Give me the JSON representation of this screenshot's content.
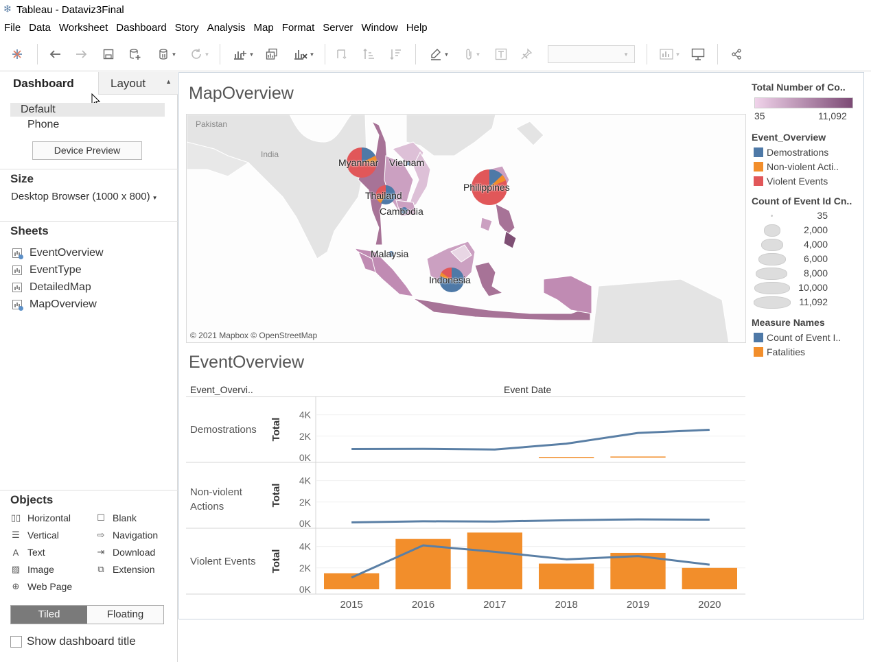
{
  "window": {
    "title": "Tableau - Dataviz3Final"
  },
  "menu": [
    "File",
    "Data",
    "Worksheet",
    "Dashboard",
    "Story",
    "Analysis",
    "Map",
    "Format",
    "Server",
    "Window",
    "Help"
  ],
  "left_panel": {
    "tab_dashboard": "Dashboard",
    "tab_layout": "Layout",
    "devices": {
      "default": "Default",
      "phone": "Phone"
    },
    "device_preview": "Device Preview",
    "size_title": "Size",
    "size_value": "Desktop Browser (1000 x 800)",
    "sheets_title": "Sheets",
    "sheets": [
      "EventOverview",
      "EventType",
      "DetailedMap",
      "MapOverview"
    ],
    "objects_title": "Objects",
    "objects": {
      "horizontal": "Horizontal",
      "blank": "Blank",
      "vertical": "Vertical",
      "navigation": "Navigation",
      "text": "Text",
      "download": "Download",
      "image": "Image",
      "extension": "Extension",
      "web_page": "Web Page"
    },
    "tiled": "Tiled",
    "floating": "Floating",
    "show_title": "Show dashboard title"
  },
  "dashboard": {
    "map_title": "MapOverview",
    "map_attribution": "© 2021 Mapbox © OpenStreetMap",
    "map_labels": {
      "pakistan": "Pakistan",
      "india": "India",
      "myanmar": "Myanmar",
      "vietnam": "Vietnam",
      "thailand": "Thailand",
      "cambodia": "Cambodia",
      "philippines": "Philippines",
      "malaysia": "Malaysia",
      "indonesia": "Indonesia"
    },
    "overview_title": "EventOverview",
    "row_header": "Event_Overvi..",
    "col_header": "Event Date"
  },
  "legends": {
    "color_title": "Total Number of Co..",
    "color_min": "35",
    "color_max": "11,092",
    "colors": {
      "demo": "#4e79a7",
      "nonviolent": "#f28e2b",
      "violent": "#e15759",
      "line": "#5a7fa5",
      "bar": "#f28e2b"
    },
    "event_title": "Event_Overview",
    "event_items": [
      "Demostrations",
      "Non-violent Acti..",
      "Violent Events"
    ],
    "size_title": "Count of Event Id Cn..",
    "size_items": [
      "35",
      "2,000",
      "4,000",
      "6,000",
      "8,000",
      "10,000",
      "11,092"
    ],
    "measure_title": "Measure Names",
    "measure_items": [
      "Count of Event I..",
      "Fatalities"
    ]
  },
  "chart_data": {
    "type": "bar",
    "x": [
      "2015",
      "2016",
      "2017",
      "2018",
      "2019",
      "2020"
    ],
    "ylabel": "Total",
    "y_ticks": [
      "4K",
      "2K",
      "0K"
    ],
    "ylim": [
      0,
      5000
    ],
    "panels": [
      {
        "name": "Demostrations",
        "series": [
          {
            "name": "Count of Event I..",
            "type": "line",
            "values": [
              800,
              820,
              750,
              1300,
              2300,
              2600
            ]
          },
          {
            "name": "Fatalities",
            "type": "bar",
            "values": [
              0,
              0,
              0,
              60,
              100,
              0
            ]
          }
        ]
      },
      {
        "name": "Non-violent Actions",
        "series": [
          {
            "name": "Count of Event I..",
            "type": "line",
            "values": [
              100,
              200,
              180,
              300,
              380,
              350
            ]
          },
          {
            "name": "Fatalities",
            "type": "bar",
            "values": [
              0,
              0,
              0,
              0,
              0,
              0
            ]
          }
        ]
      },
      {
        "name": "Violent Events",
        "series": [
          {
            "name": "Count of Event I..",
            "type": "line",
            "values": [
              1100,
              4100,
              3500,
              2800,
              3100,
              2300
            ]
          },
          {
            "name": "Fatalities",
            "type": "bar",
            "values": [
              1500,
              4700,
              5300,
              2400,
              3400,
              2000
            ]
          }
        ]
      }
    ]
  }
}
